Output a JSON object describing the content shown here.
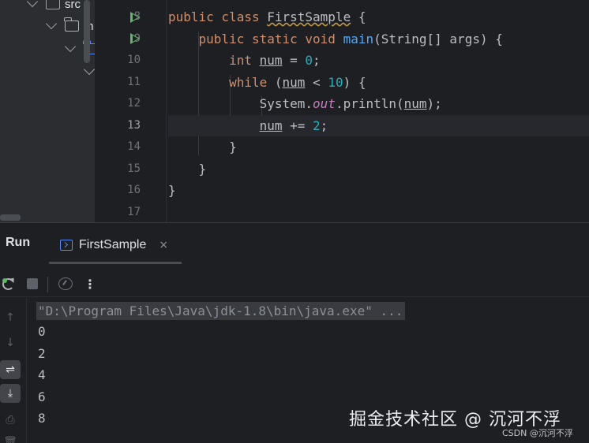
{
  "project_tree": {
    "items": [
      {
        "label": "src"
      },
      {
        "label": "m"
      },
      {
        "label": ""
      },
      {
        "label": ""
      }
    ]
  },
  "editor": {
    "line_numbers": [
      "8",
      "9",
      "10",
      "11",
      "12",
      "13",
      "14",
      "15",
      "16",
      "17"
    ],
    "current_line": "13",
    "run_gutter_lines": [
      "8",
      "9"
    ],
    "lines": [
      [
        {
          "t": "public class ",
          "c": "kw"
        },
        {
          "t": "FirstSample",
          "c": "warn"
        },
        {
          "t": " {",
          "c": ""
        }
      ],
      [
        {
          "t": "    public static void ",
          "c": "kw"
        },
        {
          "t": "main",
          "c": "fn"
        },
        {
          "t": "(String[] args) {",
          "c": ""
        }
      ],
      [
        {
          "t": "        int ",
          "c": "kw"
        },
        {
          "t": "num",
          "c": "ul"
        },
        {
          "t": " = ",
          "c": ""
        },
        {
          "t": "0",
          "c": "num"
        },
        {
          "t": ";",
          "c": ""
        }
      ],
      [
        {
          "t": "        while ",
          "c": "kw"
        },
        {
          "t": "(",
          "c": ""
        },
        {
          "t": "num",
          "c": "ul"
        },
        {
          "t": " < ",
          "c": ""
        },
        {
          "t": "10",
          "c": "num"
        },
        {
          "t": ") {",
          "c": ""
        }
      ],
      [
        {
          "t": "            System.",
          "c": ""
        },
        {
          "t": "out",
          "c": "fld"
        },
        {
          "t": ".println(",
          "c": ""
        },
        {
          "t": "num",
          "c": "ul"
        },
        {
          "t": ");",
          "c": ""
        }
      ],
      [
        {
          "t": "            ",
          "c": ""
        },
        {
          "t": "num",
          "c": "ul"
        },
        {
          "t": " += ",
          "c": ""
        },
        {
          "t": "2",
          "c": "num"
        },
        {
          "t": ";",
          "c": ""
        }
      ],
      [
        {
          "t": "        }",
          "c": ""
        }
      ],
      [
        {
          "t": "    }",
          "c": ""
        }
      ],
      [
        {
          "t": "}",
          "c": ""
        }
      ],
      [
        {
          "t": "",
          "c": ""
        }
      ]
    ]
  },
  "run_panel": {
    "title": "Run",
    "tab_label": "FirstSample",
    "tab_close": "×",
    "more_label": "⋮",
    "command": "\"D:\\Program Files\\Java\\jdk-1.8\\bin\\java.exe\" ...",
    "output": [
      "0",
      "2",
      "4",
      "6",
      "8"
    ]
  },
  "side_tools": [
    {
      "icon": "↑",
      "name": "scroll-up-icon",
      "active": false
    },
    {
      "icon": "↓",
      "name": "scroll-down-icon",
      "active": false
    },
    {
      "icon": "⇌",
      "name": "soft-wrap-icon",
      "active": true
    },
    {
      "icon": "⤓",
      "name": "scroll-to-end-icon",
      "active": true
    },
    {
      "icon": "⎙",
      "name": "print-icon",
      "active": false
    },
    {
      "icon": "🗑",
      "name": "trash-icon",
      "active": false
    }
  ],
  "watermark": {
    "main": "掘金技术社区 @ 沉河不浮",
    "small": "CSDN @沉河不浮"
  },
  "colors": {
    "keyword": "#cf8e6d",
    "function": "#56a8f5",
    "number": "#2aacb8",
    "field": "#c77dbb",
    "run_green": "#5fb865",
    "accent_blue": "#548af7"
  }
}
